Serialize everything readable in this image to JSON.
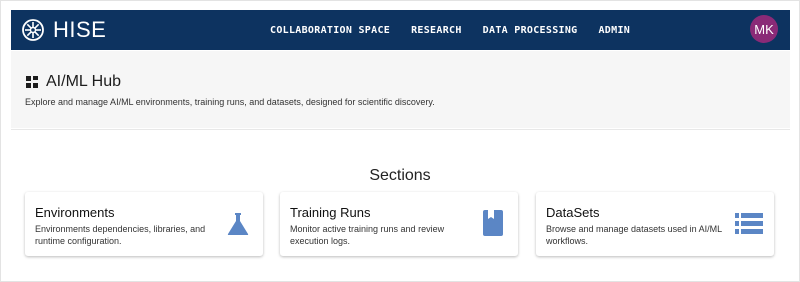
{
  "nav": {
    "brand": "HISE",
    "links": [
      "COLLABORATION SPACE",
      "RESEARCH",
      "DATA PROCESSING",
      "ADMIN"
    ],
    "avatar_initials": "MK"
  },
  "page": {
    "title": "AI/ML Hub",
    "description": "Explore and manage AI/ML environments, training runs, and datasets, designed for scientific discovery."
  },
  "sections": {
    "title": "Sections",
    "cards": [
      {
        "title": "Environments",
        "description": "Environments dependencies, libraries, and runtime configuration.",
        "icon": "flask-icon"
      },
      {
        "title": "Training Runs",
        "description": "Monitor active training runs and review execution logs.",
        "icon": "book-icon"
      },
      {
        "title": "DataSets",
        "description": "Browse and manage datasets used in AI/ML workflows.",
        "icon": "list-icon"
      }
    ]
  },
  "colors": {
    "navbar": "#0d3360",
    "avatar": "#8a2a77",
    "icon": "#5b86c5",
    "header_bg": "#f6f6f6"
  }
}
